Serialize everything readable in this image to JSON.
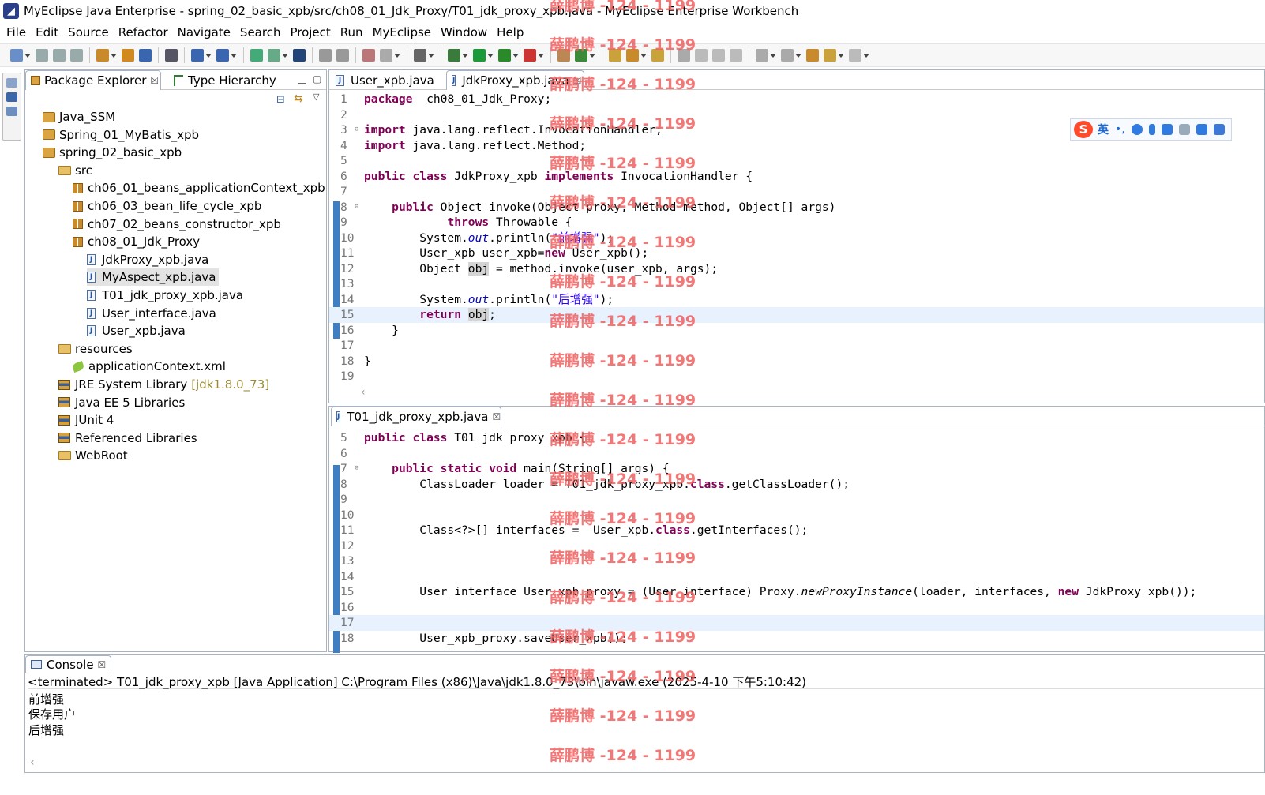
{
  "window": {
    "title": "MyEclipse Java Enterprise - spring_02_basic_xpb/src/ch08_01_Jdk_Proxy/T01_jdk_proxy_xpb.java - MyEclipse Enterprise Workbench",
    "icon": "myeclipse-icon"
  },
  "menu": [
    "File",
    "Edit",
    "Source",
    "Refactor",
    "Navigate",
    "Search",
    "Project",
    "Run",
    "MyEclipse",
    "Window",
    "Help"
  ],
  "explorer": {
    "tabs": [
      {
        "label": "Package Explorer",
        "close": "☒"
      },
      {
        "label": "Type Hierarchy"
      }
    ],
    "tree": [
      {
        "label": "Java_SSM",
        "type": "project",
        "level": 0
      },
      {
        "label": "Spring_01_MyBatis_xpb",
        "type": "project",
        "level": 0
      },
      {
        "label": "spring_02_basic_xpb",
        "type": "project",
        "level": 0
      },
      {
        "label": "src",
        "type": "folder",
        "level": 1
      },
      {
        "label": "ch06_01_beans_applicationContext_xpb",
        "type": "package",
        "level": 2
      },
      {
        "label": "ch06_03_bean_life_cycle_xpb",
        "type": "package",
        "level": 2
      },
      {
        "label": "ch07_02_beans_constructor_xpb",
        "type": "package",
        "level": 2
      },
      {
        "label": "ch08_01_Jdk_Proxy",
        "type": "package",
        "level": 2
      },
      {
        "label": "JdkProxy_xpb.java",
        "type": "java",
        "level": 3
      },
      {
        "label": "MyAspect_xpb.java",
        "type": "java",
        "level": 3,
        "selected": true
      },
      {
        "label": "T01_jdk_proxy_xpb.java",
        "type": "java",
        "level": 3
      },
      {
        "label": "User_interface.java",
        "type": "java",
        "level": 3
      },
      {
        "label": "User_xpb.java",
        "type": "java",
        "level": 3
      },
      {
        "label": "resources",
        "type": "folder",
        "level": 1
      },
      {
        "label": "applicationContext.xml",
        "type": "xml",
        "level": 2
      },
      {
        "label": "JRE System Library",
        "suffix": "[jdk1.8.0_73]",
        "type": "library",
        "level": 1
      },
      {
        "label": "Java EE 5 Libraries",
        "type": "library",
        "level": 1
      },
      {
        "label": "JUnit 4",
        "type": "library",
        "level": 1
      },
      {
        "label": "Referenced Libraries",
        "type": "library",
        "level": 1
      },
      {
        "label": "WebRoot",
        "type": "folder",
        "level": 1
      }
    ]
  },
  "editor1": {
    "tabs": [
      {
        "label": "User_xpb.java"
      },
      {
        "label": "JdkProxy_xpb.java",
        "close": "☒",
        "active": true
      }
    ],
    "lines": [
      {
        "n": "1",
        "segs": [
          [
            "kw",
            "package"
          ],
          [
            "",
            "  ch08_01_Jdk_Proxy;"
          ]
        ]
      },
      {
        "n": "2",
        "segs": []
      },
      {
        "n": "3",
        "fold": "⊖",
        "segs": [
          [
            "kw",
            "import"
          ],
          [
            "",
            " java.lang.reflect.InvocationHandler;"
          ]
        ]
      },
      {
        "n": "4",
        "segs": [
          [
            "kw",
            "import"
          ],
          [
            "",
            " java.lang.reflect.Method;"
          ]
        ]
      },
      {
        "n": "5",
        "segs": []
      },
      {
        "n": "6",
        "segs": [
          [
            "kw",
            "public"
          ],
          [
            "",
            " "
          ],
          [
            "kw",
            "class"
          ],
          [
            "",
            " JdkProxy_xpb "
          ],
          [
            "kw",
            "implements"
          ],
          [
            "",
            " InvocationHandler {"
          ]
        ]
      },
      {
        "n": "7",
        "segs": []
      },
      {
        "n": "8",
        "fold": "⊖",
        "segs": [
          [
            "",
            "    "
          ],
          [
            "kw",
            "public"
          ],
          [
            "",
            " Object invoke(Object proxy, Method method, Object[] args)"
          ]
        ]
      },
      {
        "n": "9",
        "segs": [
          [
            "",
            "            "
          ],
          [
            "kw",
            "throws"
          ],
          [
            "",
            " Throwable {"
          ]
        ]
      },
      {
        "n": "10",
        "segs": [
          [
            "",
            "        System."
          ],
          [
            "it",
            "out"
          ],
          [
            "",
            ".println("
          ],
          [
            "str",
            "\"前增强\""
          ],
          [
            "",
            ");"
          ]
        ]
      },
      {
        "n": "11",
        "segs": [
          [
            "",
            "        User_xpb user_xpb="
          ],
          [
            "kw",
            "new"
          ],
          [
            "",
            " User_xpb();"
          ]
        ]
      },
      {
        "n": "12",
        "segs": [
          [
            "",
            "        Object "
          ],
          [
            "occ",
            "obj"
          ],
          [
            "",
            " = method.invoke(user_xpb, args);"
          ]
        ]
      },
      {
        "n": "13",
        "segs": []
      },
      {
        "n": "14",
        "segs": [
          [
            "",
            "        System."
          ],
          [
            "it",
            "out"
          ],
          [
            "",
            ".println("
          ],
          [
            "str",
            "\"后增强\""
          ],
          [
            "",
            ");"
          ]
        ]
      },
      {
        "n": "15",
        "hl": true,
        "segs": [
          [
            "",
            "        "
          ],
          [
            "kw",
            "return"
          ],
          [
            "",
            " "
          ],
          [
            "occ",
            "obj"
          ],
          [
            "",
            ";"
          ]
        ]
      },
      {
        "n": "16",
        "segs": [
          [
            "",
            "    }"
          ]
        ]
      },
      {
        "n": "17",
        "segs": []
      },
      {
        "n": "18",
        "segs": [
          [
            "",
            "}"
          ]
        ]
      },
      {
        "n": "19",
        "segs": []
      }
    ]
  },
  "editor2": {
    "tabs": [
      {
        "label": "T01_jdk_proxy_xpb.java",
        "close": "☒",
        "active": true
      }
    ],
    "lines": [
      {
        "n": "5",
        "segs": [
          [
            "kw",
            "public"
          ],
          [
            "",
            " "
          ],
          [
            "kw",
            "class"
          ],
          [
            "",
            " T01_jdk_proxy_xpb {"
          ]
        ]
      },
      {
        "n": "6",
        "segs": []
      },
      {
        "n": "7",
        "fold": "⊖",
        "segs": [
          [
            "",
            "    "
          ],
          [
            "kw",
            "public"
          ],
          [
            "",
            " "
          ],
          [
            "kw",
            "static"
          ],
          [
            "",
            " "
          ],
          [
            "kw",
            "void"
          ],
          [
            "",
            " main(String[] args) {"
          ]
        ]
      },
      {
        "n": "8",
        "segs": [
          [
            "",
            "        ClassLoader loader = T01_jdk_proxy_xpb."
          ],
          [
            "kw",
            "class"
          ],
          [
            "",
            ".getClassLoader();"
          ]
        ]
      },
      {
        "n": "9",
        "segs": []
      },
      {
        "n": "10",
        "segs": []
      },
      {
        "n": "11",
        "segs": [
          [
            "",
            "        Class<?>[] interfaces =  User_xpb."
          ],
          [
            "kw",
            "class"
          ],
          [
            "",
            ".getInterfaces();"
          ]
        ]
      },
      {
        "n": "12",
        "segs": []
      },
      {
        "n": "13",
        "segs": []
      },
      {
        "n": "14",
        "segs": []
      },
      {
        "n": "15",
        "segs": [
          [
            "",
            "        User_interface User_xpb_proxy = (User_interface) Proxy."
          ],
          [
            "itm",
            "newProxyInstance"
          ],
          [
            "",
            "(loader, interfaces, "
          ],
          [
            "kw",
            "new"
          ],
          [
            "",
            " JdkProxy_xpb());"
          ]
        ]
      },
      {
        "n": "16",
        "segs": []
      },
      {
        "n": "17",
        "hl": true,
        "segs": []
      },
      {
        "n": "18",
        "segs": [
          [
            "",
            "        User_xpb_proxy.saveUser_xpb();"
          ]
        ]
      }
    ]
  },
  "console": {
    "tab": "Console",
    "close": "☒",
    "status": "<terminated> T01_jdk_proxy_xpb [Java Application] C:\\Program Files (x86)\\Java\\jdk1.8.0_73\\bin\\javaw.exe (2025-4-10 下午5:10:42)",
    "output": [
      "前增强",
      "保存用户",
      "后增强"
    ]
  },
  "ime": {
    "logo": "S",
    "mode": "英"
  },
  "watermark": "薛鹏博 -124 - 1199"
}
